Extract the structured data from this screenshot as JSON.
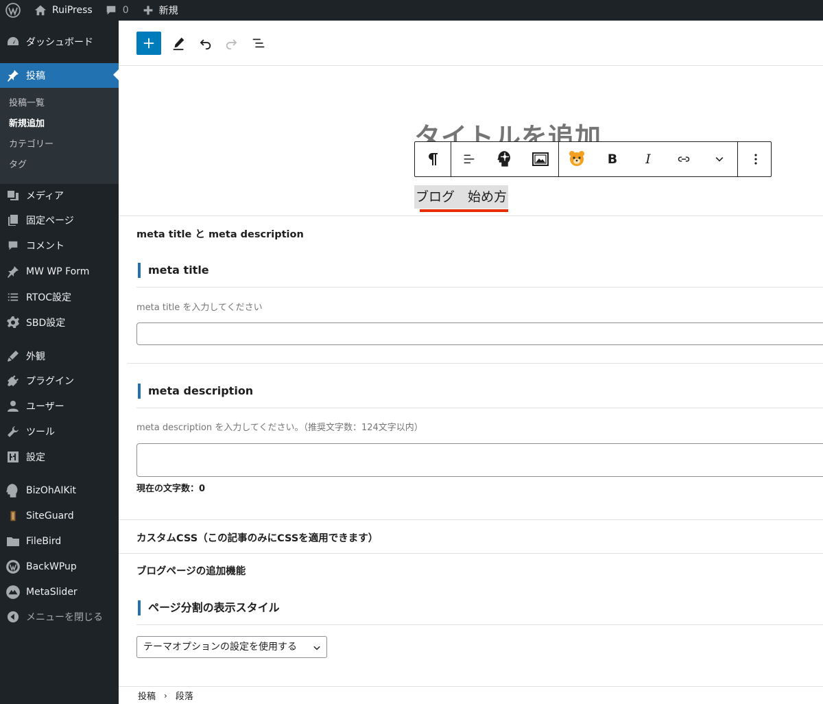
{
  "adminbar": {
    "site_name": "RuiPress",
    "comment_count": "0",
    "new_label": "新規"
  },
  "sidebar": {
    "items": [
      {
        "label": "ダッシュボード",
        "icon": "dashboard-icon"
      },
      {
        "label": "投稿",
        "icon": "pin-icon",
        "current": true
      },
      {
        "label": "メディア",
        "icon": "media-icon"
      },
      {
        "label": "固定ページ",
        "icon": "page-icon"
      },
      {
        "label": "コメント",
        "icon": "comment-icon"
      },
      {
        "label": "MW WP Form",
        "icon": "pin-icon"
      },
      {
        "label": "RTOC設定",
        "icon": "list-icon"
      },
      {
        "label": "SBD設定",
        "icon": "gear-icon"
      },
      {
        "label": "外観",
        "icon": "brush-icon"
      },
      {
        "label": "プラグイン",
        "icon": "plugin-icon"
      },
      {
        "label": "ユーザー",
        "icon": "user-icon"
      },
      {
        "label": "ツール",
        "icon": "wrench-icon"
      },
      {
        "label": "設定",
        "icon": "sliders-icon"
      },
      {
        "label": "BizOhAIKit",
        "icon": "head-icon"
      },
      {
        "label": "SiteGuard",
        "icon": "guard-icon"
      },
      {
        "label": "FileBird",
        "icon": "folder-icon"
      },
      {
        "label": "BackWPup",
        "icon": "backwpup-icon"
      },
      {
        "label": "MetaSlider",
        "icon": "metaslider-icon"
      },
      {
        "label": "メニューを閉じる",
        "icon": "collapse-icon"
      }
    ],
    "submenu": [
      "投稿一覧",
      "新規追加",
      "カテゴリー",
      "タグ"
    ],
    "submenu_current": "新規追加"
  },
  "editor": {
    "title_placeholder": "タイトルを追加",
    "paragraph_text": "ブログ　始め方",
    "block_toolbar": {
      "bold": "B",
      "italic": "I"
    }
  },
  "meta": {
    "box_title": "meta title と meta description",
    "meta_title": {
      "heading": "meta title",
      "help": "meta title を入力してください",
      "value": ""
    },
    "meta_description": {
      "heading": "meta description",
      "help": "meta description を入力してください。（推奨文字数：124文字以内）",
      "value": "",
      "char_count_label": "現在の文字数：0"
    },
    "custom_css_title": "カスタムCSS（この記事のみにCSSを適用できます）",
    "blog_extra_title": "ブログページの追加機能",
    "pagination": {
      "heading": "ページ分割の表示スタイル",
      "selected": "テーマオプションの設定を使用する"
    }
  },
  "footer": {
    "breadcrumb": [
      "投稿",
      "段落"
    ]
  },
  "colors": {
    "accent": "#2271b1",
    "adminbar": "#1d2327",
    "underline": "#e62e00"
  }
}
